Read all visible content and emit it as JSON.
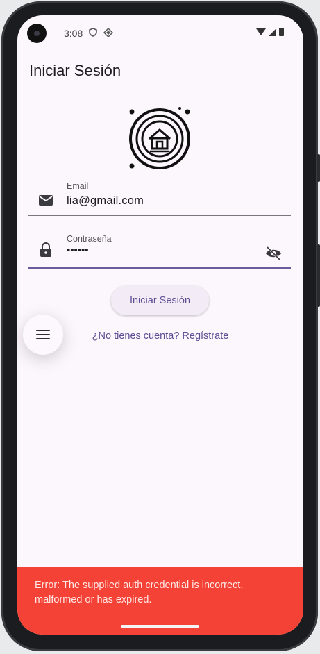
{
  "status_bar": {
    "time": "3:08",
    "icons": [
      "shield-icon",
      "app-diamond-icon",
      "wifi-icon",
      "cellular-icon",
      "battery-icon"
    ]
  },
  "app_bar": {
    "title": "Iniciar Sesión"
  },
  "form": {
    "email": {
      "label": "Email",
      "value": "lia@gmail.com",
      "icon": "mail-icon"
    },
    "password": {
      "label": "Contraseña",
      "value": "••••••",
      "icon": "lock-icon",
      "toggle_icon": "visibility-off-icon"
    },
    "submit_label": "Iniciar Sesión",
    "register_link": "¿No tienes cuenta? Regístrate"
  },
  "fab": {
    "icon": "menu-icon"
  },
  "snackbar": {
    "message": "Error: The supplied auth credential is incorrect, malformed or has expired."
  },
  "colors": {
    "background": "#fcf6fd",
    "accent": "#5f4e94",
    "error": "#f44336"
  }
}
